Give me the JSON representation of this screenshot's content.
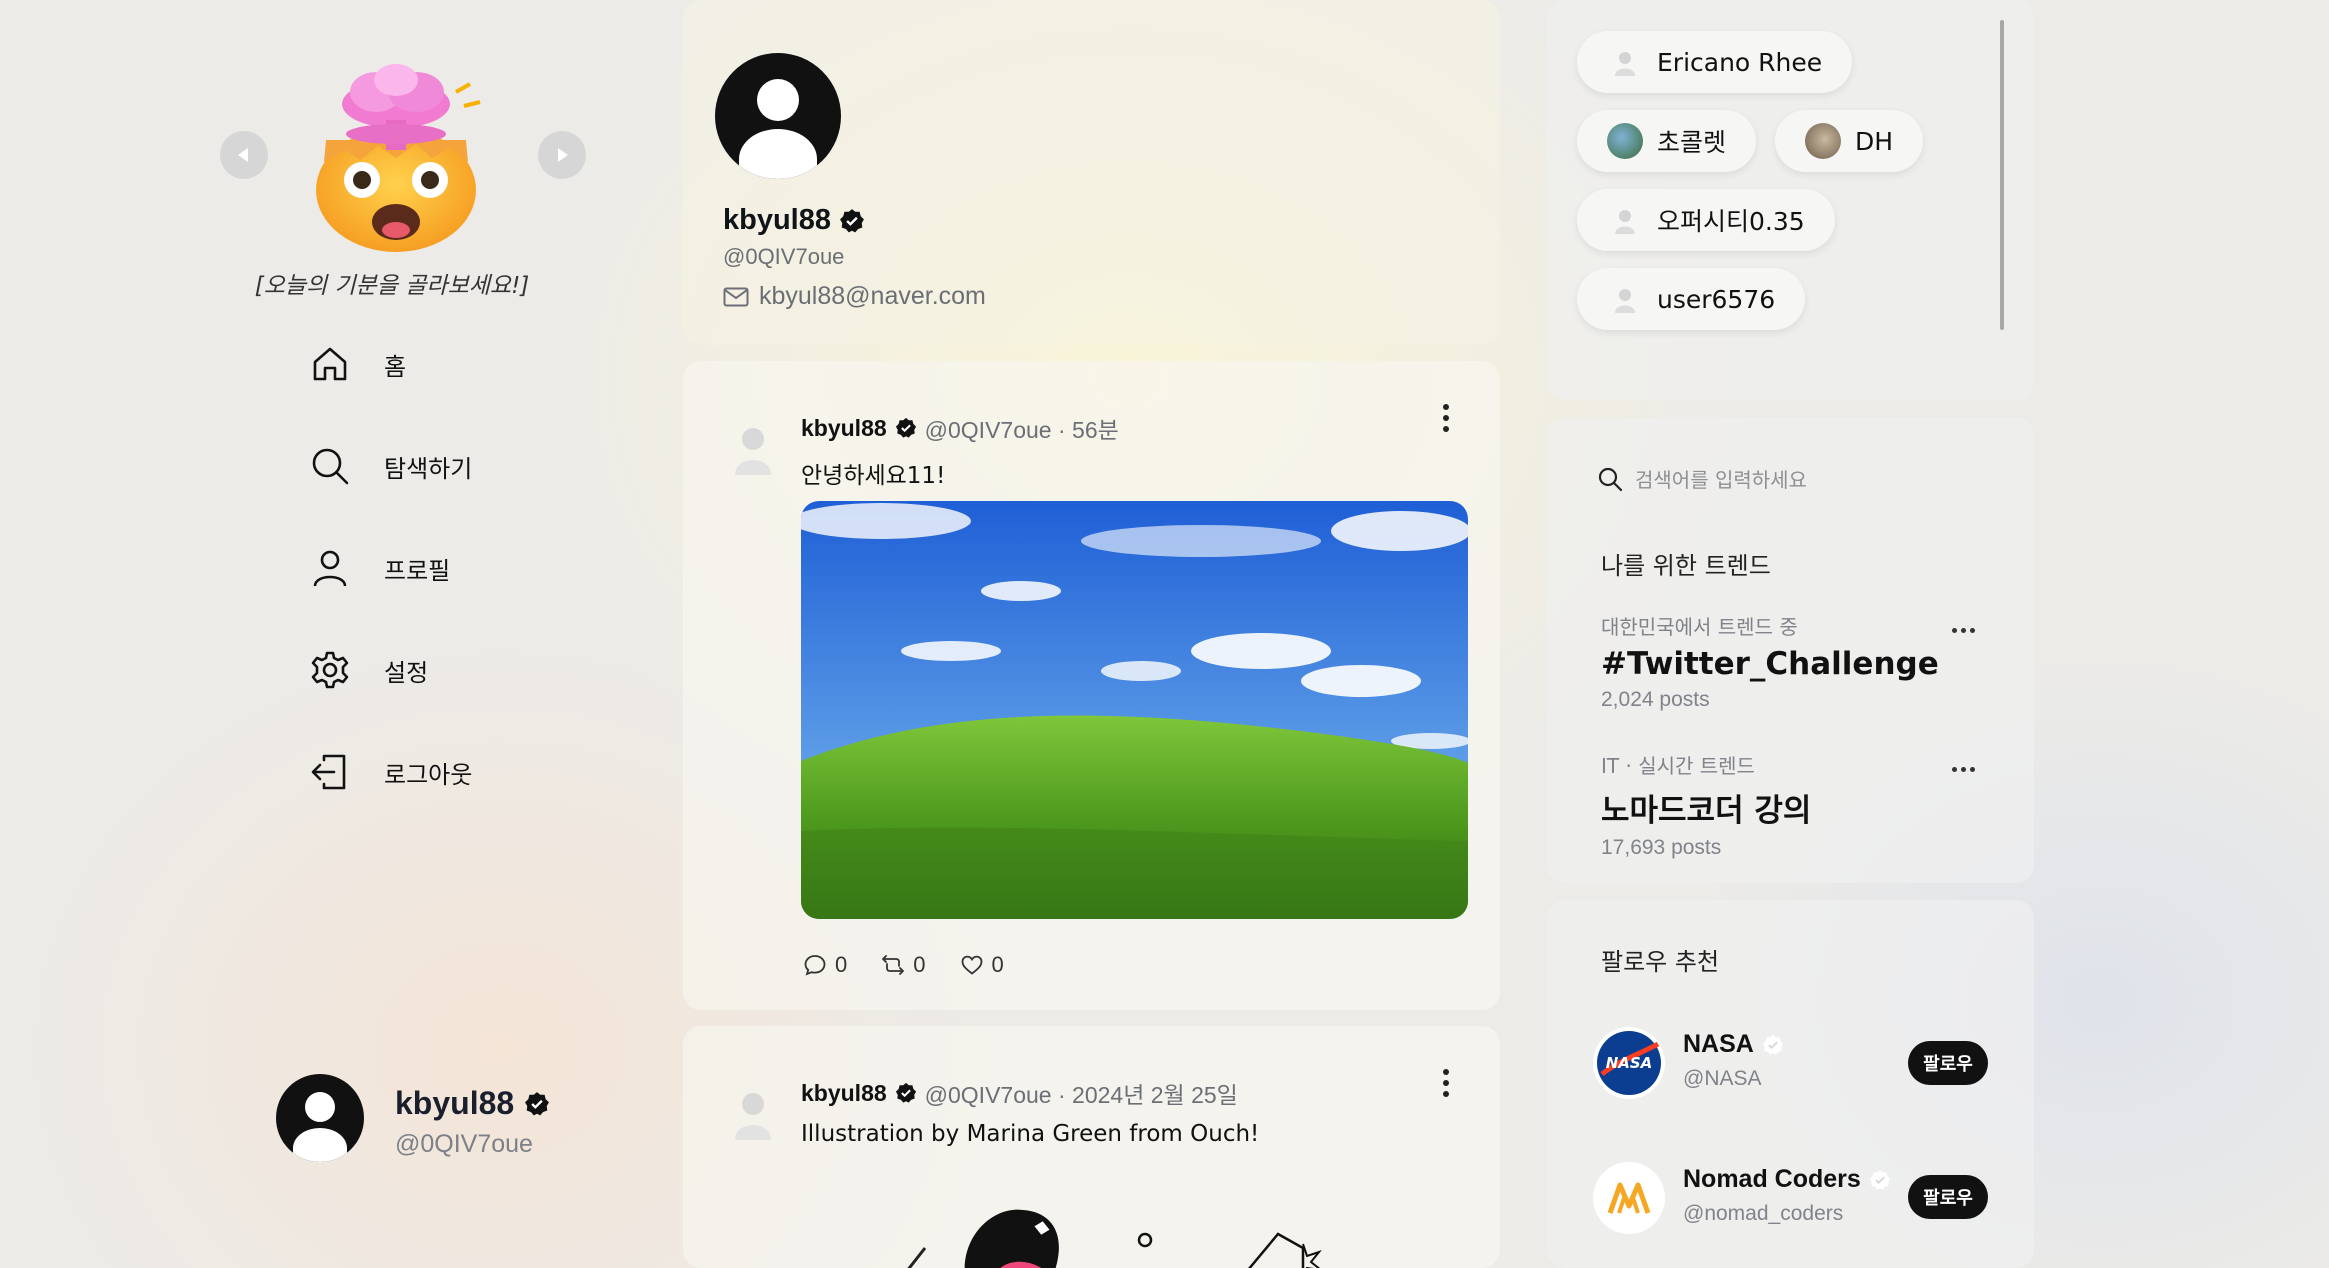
{
  "sidebar": {
    "mood_caption": "[오늘의 기분을 골라보세요!]",
    "nav": [
      {
        "label": "홈",
        "icon": "home-icon"
      },
      {
        "label": "탐색하기",
        "icon": "search-icon"
      },
      {
        "label": "프로필",
        "icon": "user-icon"
      },
      {
        "label": "설정",
        "icon": "gear-icon"
      },
      {
        "label": "로그아웃",
        "icon": "logout-icon"
      }
    ],
    "account": {
      "name": "kbyul88",
      "handle": "@0QIV7oue"
    }
  },
  "profile": {
    "name": "kbyul88",
    "handle": "@0QIV7oue",
    "email": "kbyul88@naver.com"
  },
  "posts": [
    {
      "author": "kbyul88",
      "meta": "@0QIV7oue · 56분",
      "text": "안녕하세요11!",
      "comments": "0",
      "retweets": "0",
      "likes": "0"
    },
    {
      "author": "kbyul88",
      "meta": "@0QIV7oue · 2024년 2월 25일",
      "text": "Illustration by Marina Green from Ouch!"
    }
  ],
  "users_panel": {
    "chips": [
      "Ericano Rhee",
      "초콜렛",
      "DH",
      "오퍼시티0.35",
      "user6576"
    ]
  },
  "search": {
    "placeholder": "검색어를 입력하세요"
  },
  "trends": {
    "title": "나를 위한 트렌드",
    "items": [
      {
        "context": "대한민국에서 트렌드 중",
        "name": "#Twitter_Challenge",
        "count": "2,024 posts"
      },
      {
        "context": "IT · 실시간 트렌드",
        "name": "노마드코더 강의",
        "count": "17,693 posts"
      }
    ]
  },
  "follow": {
    "title": "팔로우 추천",
    "button_label": "팔로우",
    "items": [
      {
        "name": "NASA",
        "handle": "@NASA"
      },
      {
        "name": "Nomad Coders",
        "handle": "@nomad_coders"
      }
    ]
  },
  "colors": {
    "accent": "#111111",
    "nomad": "#f5a623",
    "nasa": "#0b3d91"
  }
}
